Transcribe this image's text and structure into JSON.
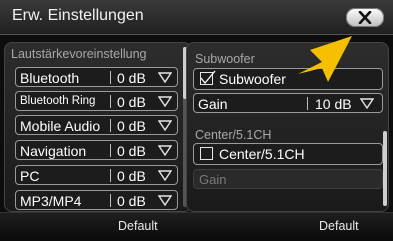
{
  "window": {
    "title": "Erw. Einstellungen"
  },
  "left_panel": {
    "section_label": "Lautstärkevoreinstellung",
    "rows": [
      {
        "label": "Bluetooth",
        "value": "0 dB"
      },
      {
        "label": "Bluetooth Ring",
        "value": "0 dB"
      },
      {
        "label": "Mobile Audio",
        "value": "0 dB"
      },
      {
        "label": "Navigation",
        "value": "0 dB"
      },
      {
        "label": "PC",
        "value": "0 dB"
      },
      {
        "label": "MP3/MP4",
        "value": "0 dB"
      }
    ]
  },
  "right_panel": {
    "subwoofer": {
      "section_label": "Subwoofer",
      "checkbox_label": "Subwoofer",
      "checked": true,
      "gain_label": "Gain",
      "gain_value": "10 dB"
    },
    "center": {
      "section_label": "Center/5.1CH",
      "checkbox_label": "Center/5.1CH",
      "checked": false,
      "gain_label": "Gain"
    }
  },
  "footer": {
    "left_button": "Default",
    "right_button": "Default"
  },
  "colors": {
    "highlight_arrow": "#f5c000",
    "background": "#0d0d0d"
  },
  "icons": {
    "close": "close-icon",
    "dropdown": "chevron-down-icon",
    "check": "check-icon"
  }
}
